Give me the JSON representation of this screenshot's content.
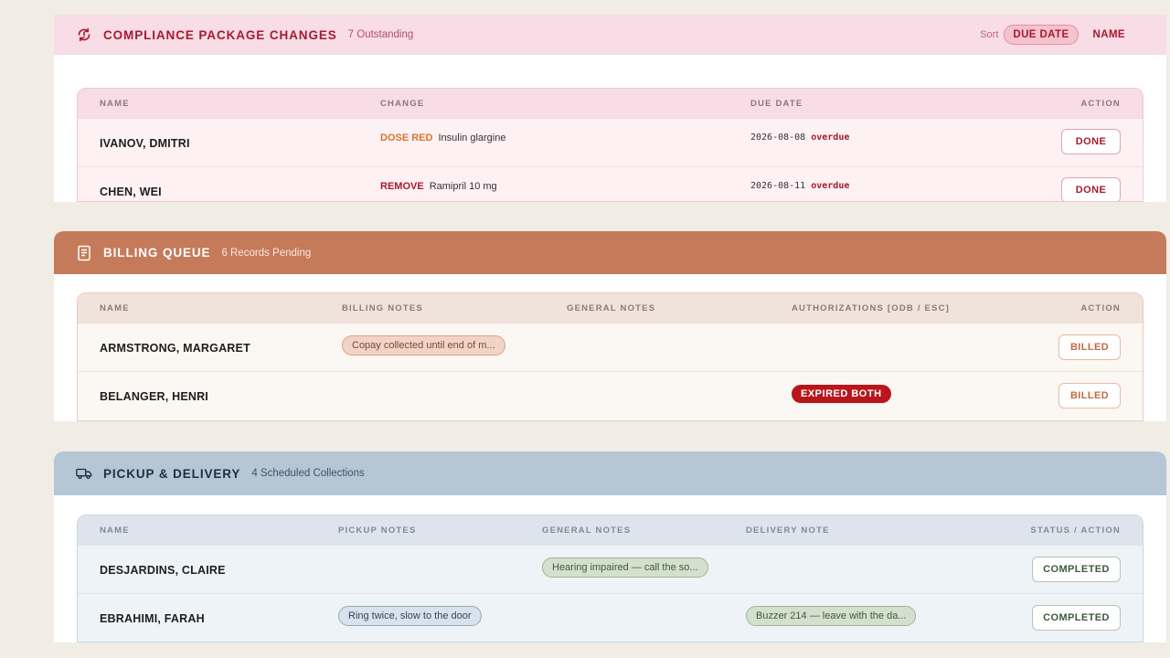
{
  "compliance": {
    "title": "COMPLIANCE PACKAGE CHANGES",
    "count": "7 Outstanding",
    "icon": "refresh-alert-icon",
    "sort_label": "Sort",
    "sort_options": [
      "DUE DATE",
      "NAME"
    ],
    "sort_active": "DUE DATE",
    "columns": [
      "NAME",
      "CHANGE",
      "DUE DATE",
      "ACTION"
    ],
    "rows": [
      {
        "name": "IVANOV, DMITRI",
        "change_type": "DOSE RED",
        "drug": "Insulin glargine",
        "due": "2026-08-08",
        "status": "overdue",
        "action": "DONE"
      },
      {
        "name": "CHEN, WEI",
        "change_type": "REMOVE",
        "drug": "Ramipril 10 mg",
        "due": "2026-08-11",
        "status": "overdue",
        "action": "DONE"
      }
    ],
    "colors": {
      "accent": "#a8192e",
      "dose_red": "#d9752c",
      "remove": "#a8192e"
    }
  },
  "billing": {
    "title": "BILLING QUEUE",
    "count": "6 Records Pending",
    "icon": "receipt-icon",
    "columns": [
      "NAME",
      "BILLING NOTES",
      "GENERAL NOTES",
      "AUTHORIZATIONS [ODB / ESC]",
      "ACTION"
    ],
    "rows": [
      {
        "name": "ARMSTRONG, MARGARET",
        "billing_note": "Copay collected until end of m...",
        "general_note": "",
        "auth": "",
        "action": "BILLED"
      },
      {
        "name": "BELANGER, HENRI",
        "billing_note": "",
        "general_note": "",
        "auth": "EXPIRED BOTH",
        "action": "BILLED"
      }
    ],
    "colors": {
      "header": "#c57a5a",
      "expired": "#b8161c"
    }
  },
  "pickup": {
    "title": "PICKUP & DELIVERY",
    "count": "4 Scheduled Collections",
    "icon": "truck-icon",
    "columns": [
      "NAME",
      "PICKUP NOTES",
      "GENERAL NOTES",
      "DELIVERY NOTE",
      "STATUS / ACTION"
    ],
    "rows": [
      {
        "name": "DESJARDINS, CLAIRE",
        "pickup_note": "",
        "general_note": "Hearing impaired — call the so...",
        "delivery_note": "",
        "action": "COMPLETED"
      },
      {
        "name": "EBRAHIMI, FARAH",
        "pickup_note": "Ring twice, slow to the door",
        "general_note": "",
        "delivery_note": "Buzzer 214 — leave with the da...",
        "action": "COMPLETED"
      }
    ],
    "colors": {
      "header": "#b5c6d5"
    }
  }
}
